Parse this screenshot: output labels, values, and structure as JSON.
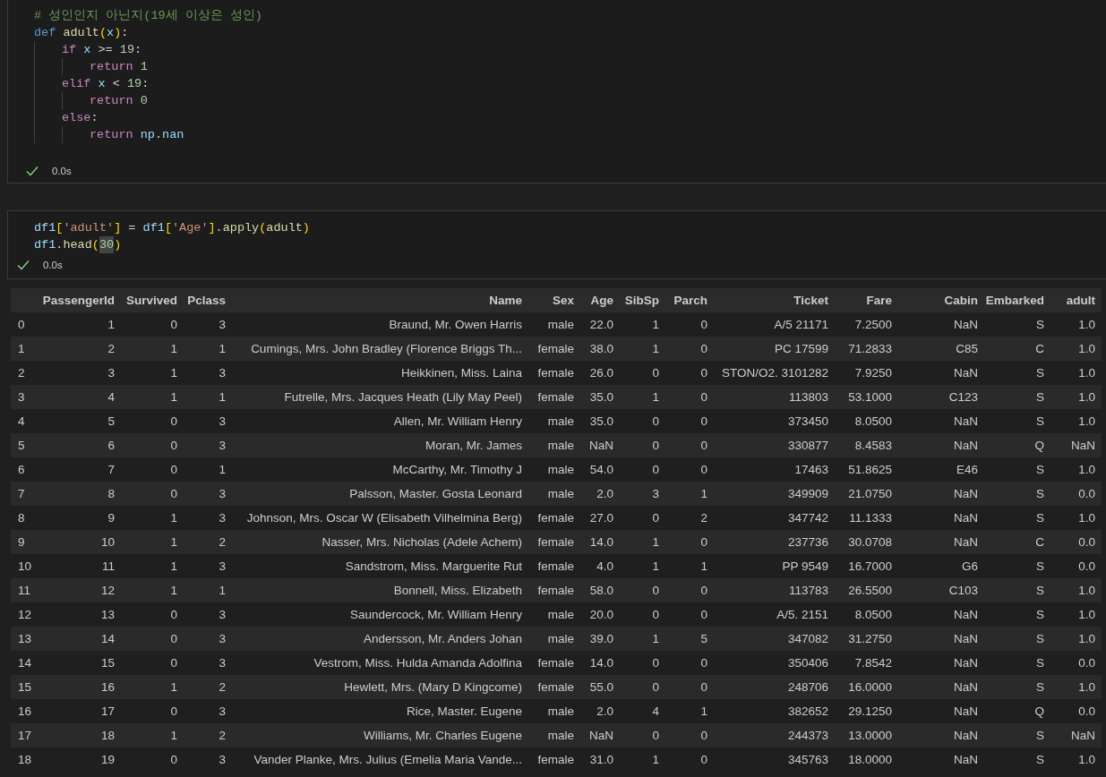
{
  "cells": [
    {
      "code": [
        [
          {
            "text": "# 성인인지 아닌지(19세 이상은 성인)",
            "kind": "comment"
          }
        ],
        [
          {
            "text": "def ",
            "kind": "keyword"
          },
          {
            "text": "adult",
            "kind": "function"
          },
          {
            "text": "(",
            "kind": "bracket"
          },
          {
            "text": "x",
            "kind": "variable"
          },
          {
            "text": ")",
            "kind": "bracket"
          },
          {
            "text": ":",
            "kind": "plain"
          }
        ],
        [
          {
            "text": "    if ",
            "kind": "control"
          },
          {
            "text": "x",
            "kind": "variable"
          },
          {
            "text": " >= ",
            "kind": "plain"
          },
          {
            "text": "19",
            "kind": "number"
          },
          {
            "text": ":",
            "kind": "plain"
          }
        ],
        [
          {
            "text": "        return ",
            "kind": "control"
          },
          {
            "text": "1",
            "kind": "number"
          }
        ],
        [
          {
            "text": "    elif ",
            "kind": "control"
          },
          {
            "text": "x",
            "kind": "variable"
          },
          {
            "text": " < ",
            "kind": "plain"
          },
          {
            "text": "19",
            "kind": "number"
          },
          {
            "text": ":",
            "kind": "plain"
          }
        ],
        [
          {
            "text": "        return ",
            "kind": "control"
          },
          {
            "text": "0",
            "kind": "number"
          }
        ],
        [
          {
            "text": "    else",
            "kind": "control"
          },
          {
            "text": ":",
            "kind": "plain"
          }
        ],
        [
          {
            "text": "        return ",
            "kind": "control"
          },
          {
            "text": "np",
            "kind": "variable"
          },
          {
            "text": ".",
            "kind": "plain"
          },
          {
            "text": "nan",
            "kind": "variable"
          }
        ]
      ],
      "status": "0.0s"
    },
    {
      "code": [
        [
          {
            "text": "df1",
            "kind": "variable"
          },
          {
            "text": "[",
            "kind": "bracket"
          },
          {
            "text": "'adult'",
            "kind": "string"
          },
          {
            "text": "]",
            "kind": "bracket"
          },
          {
            "text": " = ",
            "kind": "plain"
          },
          {
            "text": "df1",
            "kind": "variable"
          },
          {
            "text": "[",
            "kind": "bracket"
          },
          {
            "text": "'Age'",
            "kind": "string"
          },
          {
            "text": "]",
            "kind": "bracket"
          },
          {
            "text": ".",
            "kind": "plain"
          },
          {
            "text": "apply",
            "kind": "function"
          },
          {
            "text": "(",
            "kind": "bracket"
          },
          {
            "text": "adult",
            "kind": "function"
          },
          {
            "text": ")",
            "kind": "bracket"
          }
        ],
        [
          {
            "text": "df1",
            "kind": "variable"
          },
          {
            "text": ".",
            "kind": "plain"
          },
          {
            "text": "head",
            "kind": "function"
          },
          {
            "text": "(",
            "kind": "bracket"
          },
          {
            "text": "30",
            "kind": "number",
            "highlighted": true
          },
          {
            "text": ")",
            "kind": "bracket"
          }
        ]
      ],
      "status": "0.0s",
      "output": {
        "columns": [
          "",
          "PassengerId",
          "Survived",
          "Pclass",
          "Name",
          "Sex",
          "Age",
          "SibSp",
          "Parch",
          "Ticket",
          "Fare",
          "Cabin",
          "Embarked",
          "adult"
        ],
        "rows": [
          [
            "0",
            "1",
            "0",
            "3",
            "Braund, Mr. Owen Harris",
            "male",
            "22.0",
            "1",
            "0",
            "A/5 21171",
            "7.2500",
            "NaN",
            "S",
            "1.0"
          ],
          [
            "1",
            "2",
            "1",
            "1",
            "Cumings, Mrs. John Bradley (Florence Briggs Th...",
            "female",
            "38.0",
            "1",
            "0",
            "PC 17599",
            "71.2833",
            "C85",
            "C",
            "1.0"
          ],
          [
            "2",
            "3",
            "1",
            "3",
            "Heikkinen, Miss. Laina",
            "female",
            "26.0",
            "0",
            "0",
            "STON/O2. 3101282",
            "7.9250",
            "NaN",
            "S",
            "1.0"
          ],
          [
            "3",
            "4",
            "1",
            "1",
            "Futrelle, Mrs. Jacques Heath (Lily May Peel)",
            "female",
            "35.0",
            "1",
            "0",
            "113803",
            "53.1000",
            "C123",
            "S",
            "1.0"
          ],
          [
            "4",
            "5",
            "0",
            "3",
            "Allen, Mr. William Henry",
            "male",
            "35.0",
            "0",
            "0",
            "373450",
            "8.0500",
            "NaN",
            "S",
            "1.0"
          ],
          [
            "5",
            "6",
            "0",
            "3",
            "Moran, Mr. James",
            "male",
            "NaN",
            "0",
            "0",
            "330877",
            "8.4583",
            "NaN",
            "Q",
            "NaN"
          ],
          [
            "6",
            "7",
            "0",
            "1",
            "McCarthy, Mr. Timothy J",
            "male",
            "54.0",
            "0",
            "0",
            "17463",
            "51.8625",
            "E46",
            "S",
            "1.0"
          ],
          [
            "7",
            "8",
            "0",
            "3",
            "Palsson, Master. Gosta Leonard",
            "male",
            "2.0",
            "3",
            "1",
            "349909",
            "21.0750",
            "NaN",
            "S",
            "0.0"
          ],
          [
            "8",
            "9",
            "1",
            "3",
            "Johnson, Mrs. Oscar W (Elisabeth Vilhelmina Berg)",
            "female",
            "27.0",
            "0",
            "2",
            "347742",
            "11.1333",
            "NaN",
            "S",
            "1.0"
          ],
          [
            "9",
            "10",
            "1",
            "2",
            "Nasser, Mrs. Nicholas (Adele Achem)",
            "female",
            "14.0",
            "1",
            "0",
            "237736",
            "30.0708",
            "NaN",
            "C",
            "0.0"
          ],
          [
            "10",
            "11",
            "1",
            "3",
            "Sandstrom, Miss. Marguerite Rut",
            "female",
            "4.0",
            "1",
            "1",
            "PP 9549",
            "16.7000",
            "G6",
            "S",
            "0.0"
          ],
          [
            "11",
            "12",
            "1",
            "1",
            "Bonnell, Miss. Elizabeth",
            "female",
            "58.0",
            "0",
            "0",
            "113783",
            "26.5500",
            "C103",
            "S",
            "1.0"
          ],
          [
            "12",
            "13",
            "0",
            "3",
            "Saundercock, Mr. William Henry",
            "male",
            "20.0",
            "0",
            "0",
            "A/5. 2151",
            "8.0500",
            "NaN",
            "S",
            "1.0"
          ],
          [
            "13",
            "14",
            "0",
            "3",
            "Andersson, Mr. Anders Johan",
            "male",
            "39.0",
            "1",
            "5",
            "347082",
            "31.2750",
            "NaN",
            "S",
            "1.0"
          ],
          [
            "14",
            "15",
            "0",
            "3",
            "Vestrom, Miss. Hulda Amanda Adolfina",
            "female",
            "14.0",
            "0",
            "0",
            "350406",
            "7.8542",
            "NaN",
            "S",
            "0.0"
          ],
          [
            "15",
            "16",
            "1",
            "2",
            "Hewlett, Mrs. (Mary D Kingcome)",
            "female",
            "55.0",
            "0",
            "0",
            "248706",
            "16.0000",
            "NaN",
            "S",
            "1.0"
          ],
          [
            "16",
            "17",
            "0",
            "3",
            "Rice, Master. Eugene",
            "male",
            "2.0",
            "4",
            "1",
            "382652",
            "29.1250",
            "NaN",
            "Q",
            "0.0"
          ],
          [
            "17",
            "18",
            "1",
            "2",
            "Williams, Mr. Charles Eugene",
            "male",
            "NaN",
            "0",
            "0",
            "244373",
            "13.0000",
            "NaN",
            "S",
            "NaN"
          ],
          [
            "18",
            "19",
            "0",
            "3",
            "Vander Planke, Mrs. Julius (Emelia Maria Vande...",
            "female",
            "31.0",
            "1",
            "0",
            "345763",
            "18.0000",
            "NaN",
            "S",
            "1.0"
          ]
        ]
      }
    }
  ]
}
